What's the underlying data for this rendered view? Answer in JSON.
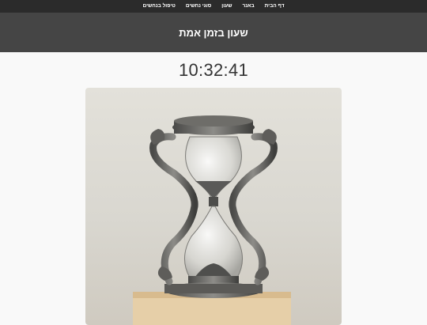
{
  "nav": {
    "items": [
      {
        "label": "דף הבית"
      },
      {
        "label": "באנר"
      },
      {
        "label": "שעון"
      },
      {
        "label": "סוגי נחשים"
      },
      {
        "label": "טיפול בנחשים"
      }
    ]
  },
  "header": {
    "title": "שעון בזמן אמת"
  },
  "clock": {
    "time": "10:32:41"
  },
  "image": {
    "subject": "hourglass-with-snakes"
  },
  "colors": {
    "nav_bg": "#2b2b2b",
    "header_bg": "#454545",
    "page_bg": "#f9f9f9",
    "clock_text": "#333333"
  }
}
